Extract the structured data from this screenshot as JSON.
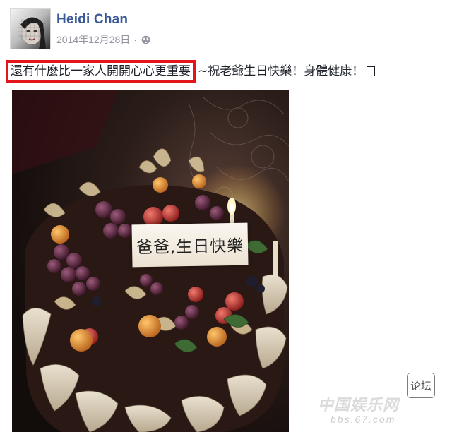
{
  "post": {
    "author": "Heidi Chan",
    "date": "2014年12月28日",
    "separator": "·",
    "audience_icon": "globe-icon",
    "text_highlighted": "還有什麼比一家人開開心心更重要",
    "text_rest": "~祝老爺生日快樂！身體健康！",
    "highlight_color": "#e3151b",
    "author_color": "#3b5998"
  },
  "photo": {
    "cake_label": "爸爸,生日快樂"
  },
  "watermark": {
    "badge": "论坛",
    "title": "中国娱乐网",
    "domain": "bbs.67.com"
  }
}
